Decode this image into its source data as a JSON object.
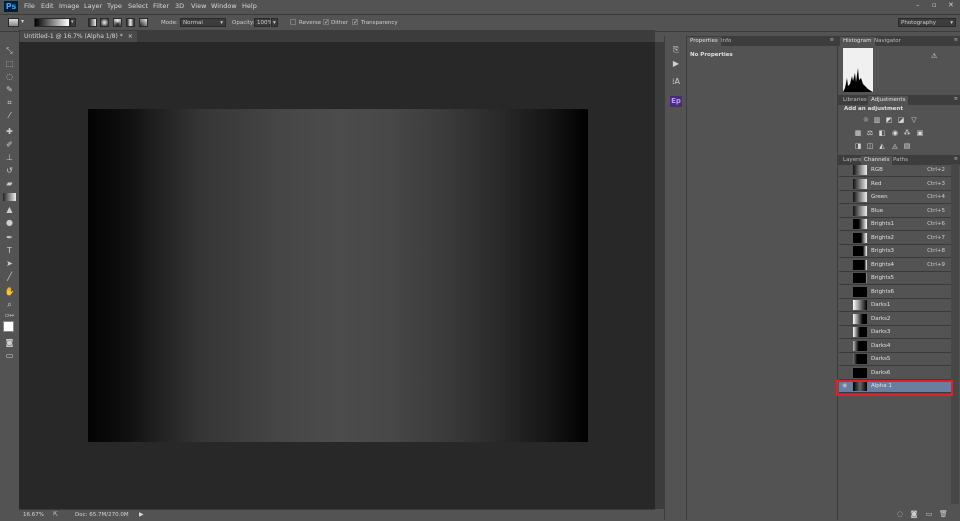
{
  "app": {
    "logo": "Ps"
  },
  "menu": [
    "File",
    "Edit",
    "Image",
    "Layer",
    "Type",
    "Select",
    "Filter",
    "3D",
    "View",
    "Window",
    "Help"
  ],
  "options": {
    "mode_label": "Mode:",
    "mode_value": "Normal",
    "opacity_label": "Opacity:",
    "opacity_value": "100%",
    "reverse": "Reverse",
    "dither": "Dither",
    "transparency": "Transparency",
    "workspace": "Photography"
  },
  "document": {
    "tab_title": "Untitled-1 @ 16.7% (Alpha 1/8) *"
  },
  "status": {
    "zoom": "16.67%",
    "doc": "Doc: 65.7M/270.0M"
  },
  "properties": {
    "tabs": [
      "Properties",
      "Info"
    ],
    "content": "No Properties"
  },
  "histogram": {
    "tabs": [
      "Histogram",
      "Navigator"
    ]
  },
  "adjustments": {
    "tabs": [
      "Libraries",
      "Adjustments"
    ],
    "heading": "Add an adjustment"
  },
  "channels_panel": {
    "tabs": [
      "Layers",
      "Channels",
      "Paths"
    ],
    "channels": [
      {
        "name": "RGB",
        "shortcut": "Ctrl+2"
      },
      {
        "name": "Red",
        "shortcut": "Ctrl+3"
      },
      {
        "name": "Green",
        "shortcut": "Ctrl+4"
      },
      {
        "name": "Blue",
        "shortcut": "Ctrl+5"
      },
      {
        "name": "Brights1",
        "shortcut": "Ctrl+6"
      },
      {
        "name": "Brights2",
        "shortcut": "Ctrl+7"
      },
      {
        "name": "Brights3",
        "shortcut": "Ctrl+8"
      },
      {
        "name": "Brights4",
        "shortcut": "Ctrl+9"
      },
      {
        "name": "Brights5",
        "shortcut": ""
      },
      {
        "name": "Brights6",
        "shortcut": ""
      },
      {
        "name": "Darks1",
        "shortcut": ""
      },
      {
        "name": "Darks2",
        "shortcut": ""
      },
      {
        "name": "Darks3",
        "shortcut": ""
      },
      {
        "name": "Darks4",
        "shortcut": ""
      },
      {
        "name": "Darks5",
        "shortcut": ""
      },
      {
        "name": "Darks6",
        "shortcut": ""
      },
      {
        "name": "Alpha 1",
        "shortcut": "",
        "selected": true
      }
    ]
  },
  "colors": {
    "highlight": "#e0202a",
    "selected_row": "#6a7fa0",
    "panel": "#535353",
    "canvas_bg": "#282828"
  }
}
